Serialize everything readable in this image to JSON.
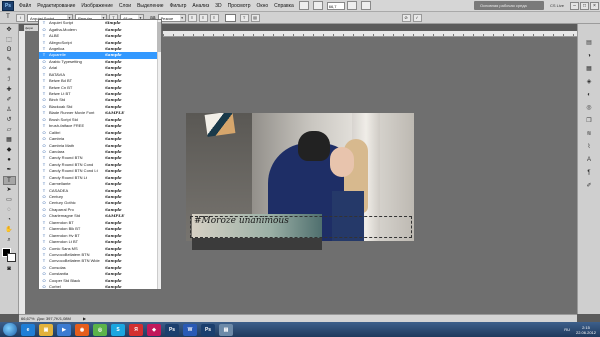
{
  "menubar": {
    "app_icon": "Ps",
    "items": [
      "Файл",
      "Редактирование",
      "Изображение",
      "Слои",
      "Выделение",
      "Фильтр",
      "Анализ",
      "3D",
      "Просмотр",
      "Окно",
      "Справка"
    ],
    "zoom": "66,7",
    "workspace_button": "Основная рабочая среда",
    "cs_live": "CS Live",
    "controls": [
      "–",
      "□",
      "×"
    ]
  },
  "options": {
    "tool_icon": "T",
    "font_family": "Arquiet Script",
    "font_style": "Regular",
    "font_size": "48 пт",
    "aa_label": "aa",
    "aa_mode": "Резкое",
    "align_icons": [
      "align-left-icon",
      "align-center-icon",
      "align-right-icon"
    ],
    "color_hex": "#ffffff"
  },
  "doc_tab": "форм",
  "font_list": {
    "selected_index": 5,
    "items": [
      {
        "name": "Arquiet Script",
        "sample": "Simple",
        "icon": "T"
      },
      {
        "name": "Agatha-Modern",
        "sample": "Sample",
        "icon": "O"
      },
      {
        "name": "ALBE",
        "sample": "Sample",
        "icon": "T"
      },
      {
        "name": "AllegroScript",
        "sample": "Sample",
        "icon": "T"
      },
      {
        "name": "Angelica",
        "sample": "Sample",
        "icon": "T"
      },
      {
        "name": "Aquarelle",
        "sample": "Sample",
        "icon": "T"
      },
      {
        "name": "Arabic Typesetting",
        "sample": "Sample",
        "icon": "O"
      },
      {
        "name": "Arial",
        "sample": "Sample",
        "icon": "O"
      },
      {
        "name": "BATAVIA",
        "sample": "Sample",
        "icon": "T"
      },
      {
        "name": "Belwe Bd BT",
        "sample": "Sample",
        "icon": "T"
      },
      {
        "name": "Belwe Cn BT",
        "sample": "Sample",
        "icon": "T"
      },
      {
        "name": "Belwe Lt BT",
        "sample": "Sample",
        "icon": "T"
      },
      {
        "name": "Birch Std",
        "sample": "Sample",
        "icon": "O"
      },
      {
        "name": "Blackoak Std",
        "sample": "Sample",
        "icon": "O"
      },
      {
        "name": "Blade Runner Movie Font",
        "sample": "SAMPLE",
        "icon": "T"
      },
      {
        "name": "Brush Script Std",
        "sample": "Sample",
        "icon": "O"
      },
      {
        "name": "brush-fatface FREE",
        "sample": "Sample",
        "icon": "T"
      },
      {
        "name": "Calibri",
        "sample": "Sample",
        "icon": "O"
      },
      {
        "name": "Cambria",
        "sample": "Sample",
        "icon": "O"
      },
      {
        "name": "Cambria Math",
        "sample": "Sample",
        "icon": "O"
      },
      {
        "name": "Candara",
        "sample": "Sample",
        "icon": "O"
      },
      {
        "name": "Candy Round BTN",
        "sample": "Sample",
        "icon": "T"
      },
      {
        "name": "Candy Round BTN Cond",
        "sample": "Sample",
        "icon": "T"
      },
      {
        "name": "Candy Round BTN Cond Lt",
        "sample": "Sample",
        "icon": "T"
      },
      {
        "name": "Candy Round BTN Lt",
        "sample": "Sample",
        "icon": "T"
      },
      {
        "name": "Carmellante",
        "sample": "Sample",
        "icon": "T"
      },
      {
        "name": "CASADEA",
        "sample": "Sample",
        "icon": "T"
      },
      {
        "name": "Century",
        "sample": "Sample",
        "icon": "O"
      },
      {
        "name": "Century Gothic",
        "sample": "Sample",
        "icon": "O"
      },
      {
        "name": "Chaparral Pro",
        "sample": "Sample",
        "icon": "O"
      },
      {
        "name": "Charlemagne Std",
        "sample": "SAMPLE",
        "icon": "O"
      },
      {
        "name": "Clarendon BT",
        "sample": "Sample",
        "icon": "T"
      },
      {
        "name": "Clarendon Blk BT",
        "sample": "Sample",
        "icon": "T"
      },
      {
        "name": "Clarendon Hv BT",
        "sample": "Sample",
        "icon": "T"
      },
      {
        "name": "Clarendon Lt BT",
        "sample": "Sample",
        "icon": "T"
      },
      {
        "name": "Comic Sans MS",
        "sample": "Sample",
        "icon": "O"
      },
      {
        "name": "ConvocoBellatem BTN",
        "sample": "Sample",
        "icon": "T"
      },
      {
        "name": "ConvocoBellatem BTN Wide",
        "sample": "Sample",
        "icon": "T"
      },
      {
        "name": "Consolas",
        "sample": "Sample",
        "icon": "O"
      },
      {
        "name": "Constantia",
        "sample": "Sample",
        "icon": "O"
      },
      {
        "name": "Cooper Std Black",
        "sample": "Sample",
        "icon": "O"
      },
      {
        "name": "Corbel",
        "sample": "Sample",
        "icon": "O"
      }
    ]
  },
  "canvas": {
    "text": "#Moroze  unanimous"
  },
  "status": {
    "zoom": "66,67%",
    "doc": "Док: 397,7K/1,08M"
  },
  "taskbar": {
    "apps": [
      {
        "label": "e",
        "color": "#1f7ed6"
      },
      {
        "label": "▣",
        "color": "#e2b23c"
      },
      {
        "label": "▶",
        "color": "#3b7bd1"
      },
      {
        "label": "◉",
        "color": "#e55d1c"
      },
      {
        "label": "◎",
        "color": "#5bb34a"
      },
      {
        "label": "S",
        "color": "#1aa6e0"
      },
      {
        "label": "Я",
        "color": "#d32f2f"
      },
      {
        "label": "◆",
        "color": "#c2185b"
      },
      {
        "label": "Ps",
        "color": "#1b3f6e"
      },
      {
        "label": "W",
        "color": "#2a5ab5"
      },
      {
        "label": "Ps",
        "color": "#1b3f6e"
      },
      {
        "label": "▤",
        "color": "#6d8aa8"
      }
    ],
    "lang": "RU",
    "time": "2:15",
    "date": "22.06.2012"
  }
}
